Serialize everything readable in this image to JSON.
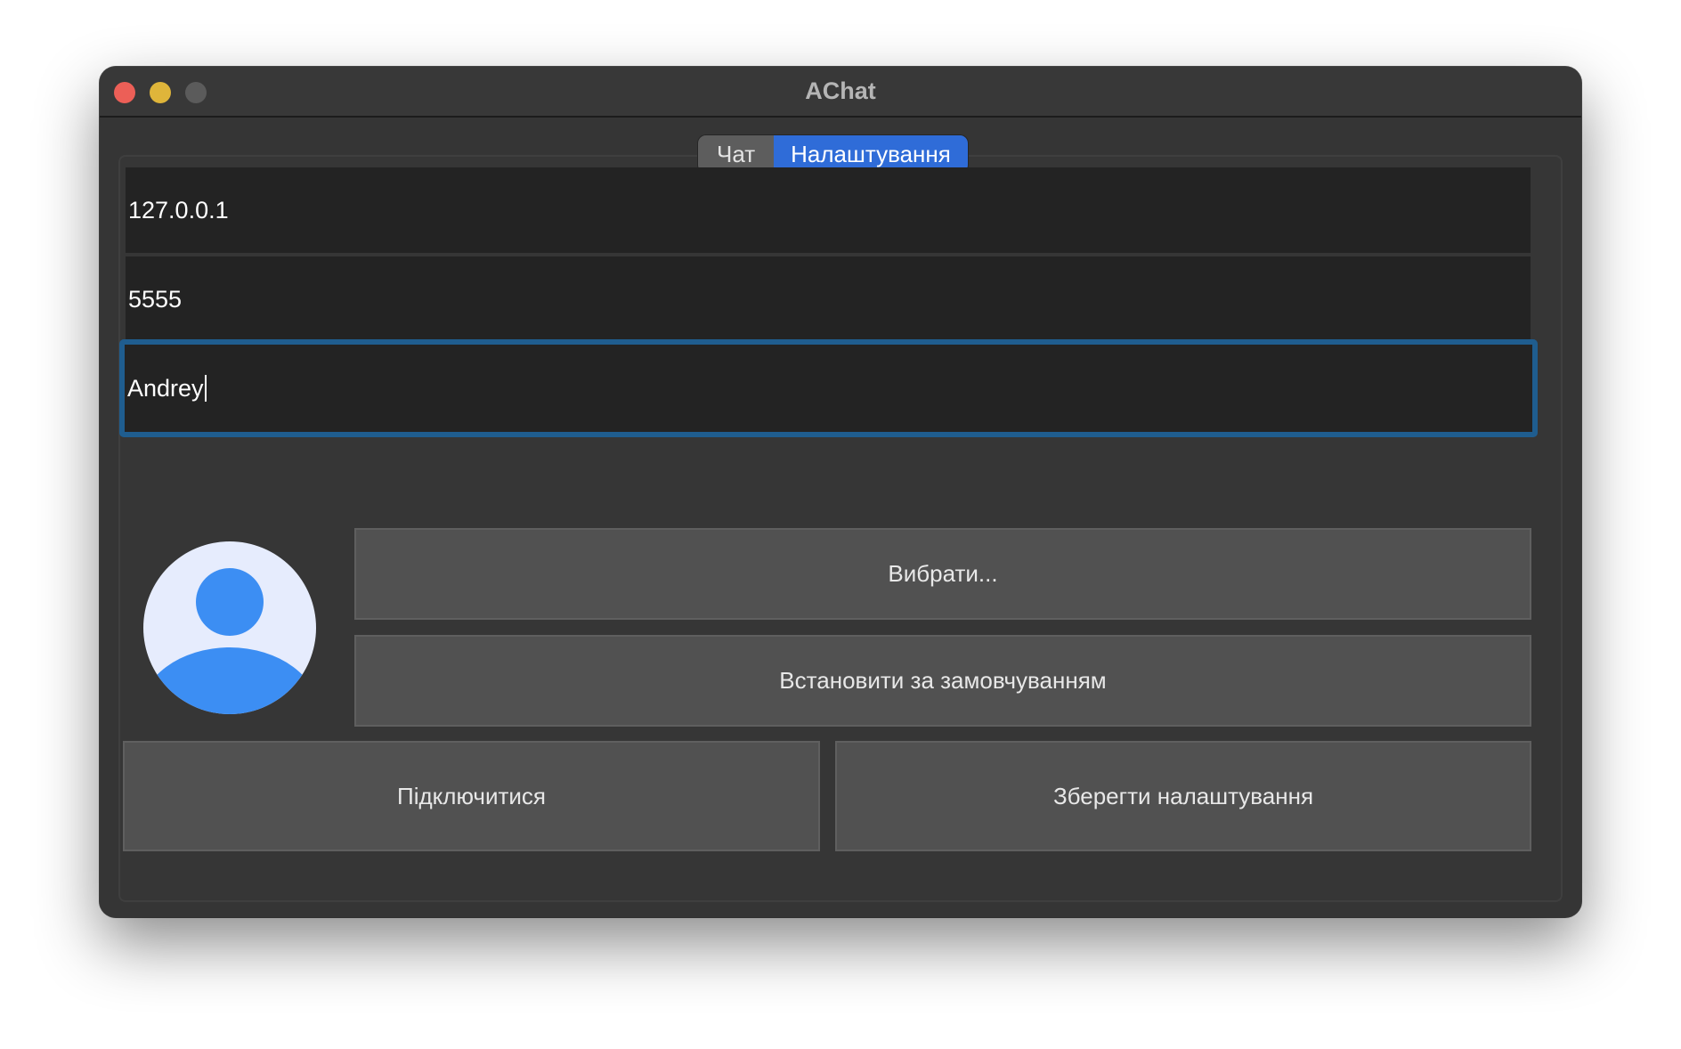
{
  "window": {
    "title": "AChat"
  },
  "tabs": [
    {
      "label": "Чат",
      "active": false
    },
    {
      "label": "Налаштування",
      "active": true
    }
  ],
  "settings": {
    "host_value": "127.0.0.1",
    "port_value": "5555",
    "username_value": "Andrey",
    "choose_avatar_label": "Вибрати...",
    "set_default_label": "Встановити за замовчуванням",
    "connect_label": "Підключитися",
    "save_label": "Зберегти налаштування"
  },
  "icons": {
    "avatar": "user-avatar-icon"
  },
  "colors": {
    "accent": "#2f6cd8",
    "focus_ring": "#1f5d8f",
    "avatar_blue": "#3c8ef3",
    "avatar_bg": "#e6ecfd"
  }
}
